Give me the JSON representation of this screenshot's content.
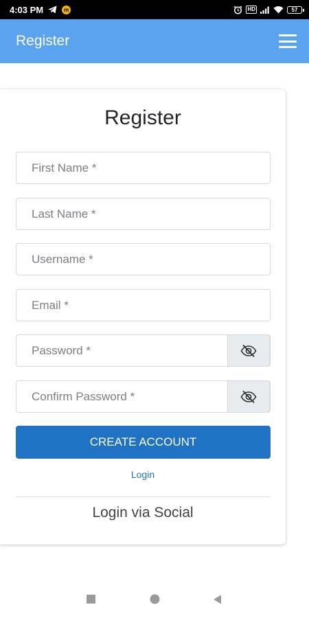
{
  "status_bar": {
    "time": "4:03 PM",
    "notif_badge": "m",
    "sim_label": "HD",
    "battery": "57",
    "icons": [
      "telegram-icon",
      "alarm-icon",
      "signal-icon",
      "wifi-icon",
      "battery-icon"
    ]
  },
  "app_bar": {
    "title": "Register",
    "menu_icon": "hamburger-menu-icon",
    "color": "#5aa3ee"
  },
  "form": {
    "heading": "Register",
    "fields": {
      "first_name": {
        "placeholder": "First Name *",
        "value": ""
      },
      "last_name": {
        "placeholder": "Last Name *",
        "value": ""
      },
      "username": {
        "placeholder": "Username *",
        "value": ""
      },
      "email": {
        "placeholder": "Email *",
        "value": ""
      },
      "password": {
        "placeholder": "Password *",
        "value": ""
      },
      "confirm_password": {
        "placeholder": "Confirm Password *",
        "value": ""
      }
    },
    "toggle_icon": "eye-slash-icon",
    "submit_label": "CREATE ACCOUNT",
    "submit_color": "#1f72c4",
    "login_link": "Login",
    "social_heading": "Login via Social"
  },
  "nav_bar": {
    "icons": [
      "recent-apps-icon",
      "home-icon",
      "back-icon"
    ]
  }
}
